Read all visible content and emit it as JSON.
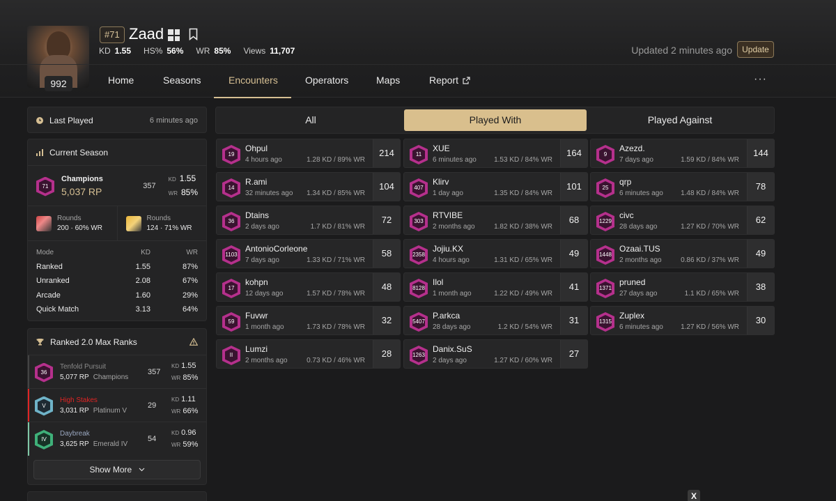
{
  "profile": {
    "rank_tag": "#71",
    "name": "Zaad",
    "level": "992",
    "stats": [
      {
        "label": "KD",
        "value": "1.55"
      },
      {
        "label": "HS%",
        "value": "56%"
      },
      {
        "label": "WR",
        "value": "85%"
      },
      {
        "label": "Views",
        "value": "11,707"
      }
    ],
    "updated_text": "Updated 2 minutes ago",
    "update_label": "Update",
    "platform_icon": "windows-icon",
    "accent": "#d6bf93"
  },
  "nav": {
    "items": [
      "Home",
      "Seasons",
      "Encounters",
      "Operators",
      "Maps",
      "Report"
    ],
    "active": "Encounters",
    "more": "···"
  },
  "sidebar": {
    "last_played": {
      "label": "Last Played",
      "value": "6 minutes ago"
    },
    "current_season": {
      "title": "Current Season",
      "rank_name": "Champions",
      "badge": "71",
      "rp": "5,037 RP",
      "count": "357",
      "kd_label": "KD",
      "kd": "1.55",
      "wr_label": "WR",
      "wr": "85%",
      "rounds": [
        {
          "label": "Rounds",
          "value": "200 · 60% WR"
        },
        {
          "label": "Rounds",
          "value": "124 · 71% WR"
        }
      ],
      "mode_header": [
        "Mode",
        "KD",
        "WR"
      ],
      "modes": [
        {
          "mode": "Ranked",
          "kd": "1.55",
          "wr": "87%"
        },
        {
          "mode": "Unranked",
          "kd": "2.08",
          "wr": "67%"
        },
        {
          "mode": "Arcade",
          "kd": "1.60",
          "wr": "29%"
        },
        {
          "mode": "Quick Match",
          "kd": "3.13",
          "wr": "64%"
        }
      ]
    },
    "max_ranks": {
      "title": "Ranked 2.0 Max Ranks",
      "items": [
        {
          "season": "Tenfold Pursuit",
          "badge": "36",
          "rp": "5,077 RP",
          "rank": "Champions",
          "count": "357",
          "kd": "1.55",
          "wr": "85%",
          "color": "#8a8a8a"
        },
        {
          "season": "High Stakes",
          "badge": "V",
          "rp": "3,031 RP",
          "rank": "Platinum V",
          "count": "29",
          "kd": "1.11",
          "wr": "66%",
          "color": "#e02424"
        },
        {
          "season": "Daybreak",
          "badge": "IV",
          "rp": "3,625 RP",
          "rank": "Emerald IV",
          "count": "54",
          "kd": "0.96",
          "wr": "59%",
          "color": "#9aa7c0"
        }
      ],
      "show_more": "Show More"
    }
  },
  "tabs": [
    "All",
    "Played With",
    "Played Against"
  ],
  "encounters": [
    {
      "name": "Ohpul",
      "badge": "19",
      "time": "4 hours ago",
      "stat": "1.28 KD / 89% WR",
      "count": "214"
    },
    {
      "name": "XUE",
      "badge": "11",
      "time": "6 minutes ago",
      "stat": "1.53 KD / 84% WR",
      "count": "164"
    },
    {
      "name": "Azezd.",
      "badge": "9",
      "time": "7 days ago",
      "stat": "1.59 KD / 84% WR",
      "count": "144"
    },
    {
      "name": "R.ami",
      "badge": "14",
      "time": "32 minutes ago",
      "stat": "1.34 KD / 85% WR",
      "count": "104"
    },
    {
      "name": "Klirv",
      "badge": "407",
      "time": "1 day ago",
      "stat": "1.35 KD / 84% WR",
      "count": "101"
    },
    {
      "name": "qrp",
      "badge": "25",
      "time": "6 minutes ago",
      "stat": "1.48 KD / 84% WR",
      "count": "78"
    },
    {
      "name": "Dtains",
      "badge": "36",
      "time": "2 days ago",
      "stat": "1.7 KD / 81% WR",
      "count": "72"
    },
    {
      "name": "RTVIBE",
      "badge": "303",
      "time": "2 months ago",
      "stat": "1.82 KD / 38% WR",
      "count": "68"
    },
    {
      "name": "civc",
      "badge": "1229",
      "time": "28 days ago",
      "stat": "1.27 KD / 70% WR",
      "count": "62"
    },
    {
      "name": "AntonioCorleone",
      "badge": "1103",
      "time": "7 days ago",
      "stat": "1.33 KD / 71% WR",
      "count": "58"
    },
    {
      "name": "Jojiu.KX",
      "badge": "2358",
      "time": "4 hours ago",
      "stat": "1.31 KD / 65% WR",
      "count": "49"
    },
    {
      "name": "Ozaai.TUS",
      "badge": "1448",
      "time": "2 months ago",
      "stat": "0.86 KD / 37% WR",
      "count": "49"
    },
    {
      "name": "kohpn",
      "badge": "17",
      "time": "12 days ago",
      "stat": "1.57 KD / 78% WR",
      "count": "48"
    },
    {
      "name": "Ilol",
      "badge": "8128",
      "time": "1 month ago",
      "stat": "1.22 KD / 49% WR",
      "count": "41"
    },
    {
      "name": "pruned",
      "badge": "1371",
      "time": "27 days ago",
      "stat": "1.1 KD / 65% WR",
      "count": "38"
    },
    {
      "name": "Fuvwr",
      "badge": "59",
      "time": "1 month ago",
      "stat": "1.73 KD / 78% WR",
      "count": "32"
    },
    {
      "name": "P.arkca",
      "badge": "5407",
      "time": "28 days ago",
      "stat": "1.2 KD / 54% WR",
      "count": "31"
    },
    {
      "name": "Zuplex",
      "badge": "1315",
      "time": "6 minutes ago",
      "stat": "1.27 KD / 56% WR",
      "count": "30"
    },
    {
      "name": "Lumzi",
      "badge": "II",
      "time": "2 months ago",
      "stat": "0.73 KD / 46% WR",
      "count": "28"
    },
    {
      "name": "Danix.SuS",
      "badge": "1263",
      "time": "2 days ago",
      "stat": "1.27 KD / 60% WR",
      "count": "27"
    }
  ],
  "overlay_close": "X"
}
